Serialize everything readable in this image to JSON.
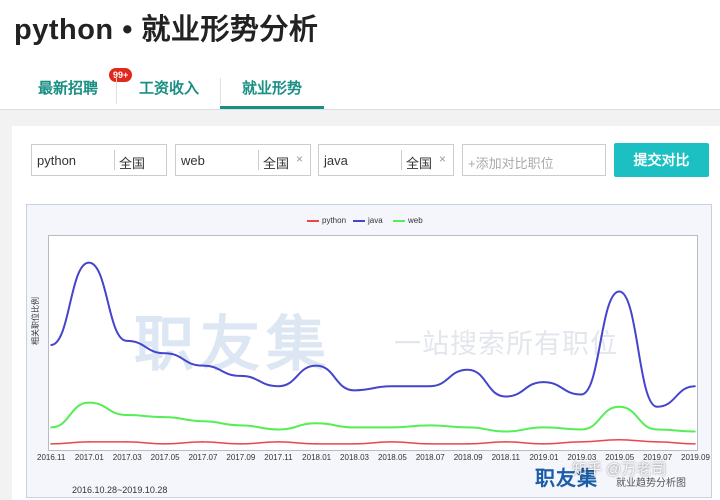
{
  "page": {
    "title": "python • 就业形势分析"
  },
  "tabs": [
    {
      "label": "最新招聘",
      "badge": "99+"
    },
    {
      "label": "工资收入"
    },
    {
      "label": "就业形势",
      "active": true
    }
  ],
  "compare": {
    "jobs": [
      {
        "name": "python",
        "region": "全国"
      },
      {
        "name": "web",
        "region": "全国",
        "remove": "×"
      },
      {
        "name": "java",
        "region": "全国",
        "remove": "×"
      }
    ],
    "add_placeholder": "+添加对比职位",
    "submit_label": "提交对比"
  },
  "chart": {
    "watermark_logo": "职友集",
    "watermark_slogan": "一站搜索所有职位",
    "date_range": "2016.10.28~2019.10.28",
    "colors": {
      "python": "#e8474a",
      "java": "#4444cc",
      "web": "#55ee55"
    }
  },
  "chart_data": {
    "type": "line",
    "ylabel": "相关职位比例",
    "legend_position": "top-center",
    "x": [
      "2016.11",
      "2017.01",
      "2017.03",
      "2017.05",
      "2017.07",
      "2017.09",
      "2017.11",
      "2018.01",
      "2018.03",
      "2018.05",
      "2018.07",
      "2018.09",
      "2018.11",
      "2019.01",
      "2019.03",
      "2019.05",
      "2019.07",
      "2019.09"
    ],
    "series": [
      {
        "name": "python",
        "values": [
          0.02,
          0.03,
          0.03,
          0.02,
          0.03,
          0.02,
          0.03,
          0.02,
          0.02,
          0.03,
          0.02,
          0.02,
          0.03,
          0.02,
          0.03,
          0.04,
          0.03,
          0.02
        ]
      },
      {
        "name": "java",
        "values": [
          0.5,
          0.9,
          0.52,
          0.46,
          0.4,
          0.35,
          0.3,
          0.4,
          0.28,
          0.3,
          0.3,
          0.38,
          0.25,
          0.32,
          0.26,
          0.76,
          0.2,
          0.3
        ]
      },
      {
        "name": "web",
        "values": [
          0.1,
          0.22,
          0.16,
          0.15,
          0.13,
          0.11,
          0.09,
          0.12,
          0.1,
          0.1,
          0.11,
          0.1,
          0.08,
          0.1,
          0.09,
          0.2,
          0.09,
          0.08
        ]
      }
    ],
    "ylim": [
      0,
      1
    ],
    "grid": false
  },
  "branding": {
    "logo": "职友集",
    "subtitle": "就业趋势分析图",
    "zhihu": "知乎 @万老司"
  }
}
